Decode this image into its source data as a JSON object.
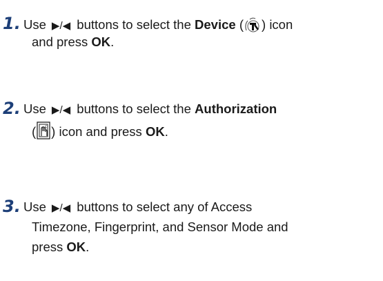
{
  "steps": [
    {
      "number": "1.",
      "use": "Use",
      "arrows": "▶/◀",
      "select_text": "buttons to select the",
      "target": "Device",
      "icon": "device-icon",
      "after_icon": "icon",
      "line2_prefix": "and press",
      "key": "OK",
      "end": "."
    },
    {
      "number": "2.",
      "use": "Use",
      "arrows": "▶/◀",
      "select_text": "buttons to select the",
      "target": "Authorization",
      "icon": "authorization-icon",
      "line2_suffix": "icon and press",
      "key": "OK",
      "end": "."
    },
    {
      "number": "3.",
      "use": "Use",
      "arrows": "▶/◀",
      "line1_rest": "buttons to select any of Access",
      "line2": "Timezone, Fingerprint, and Sensor Mode and",
      "line3_prefix": "press",
      "key": "OK",
      "end": "."
    }
  ]
}
